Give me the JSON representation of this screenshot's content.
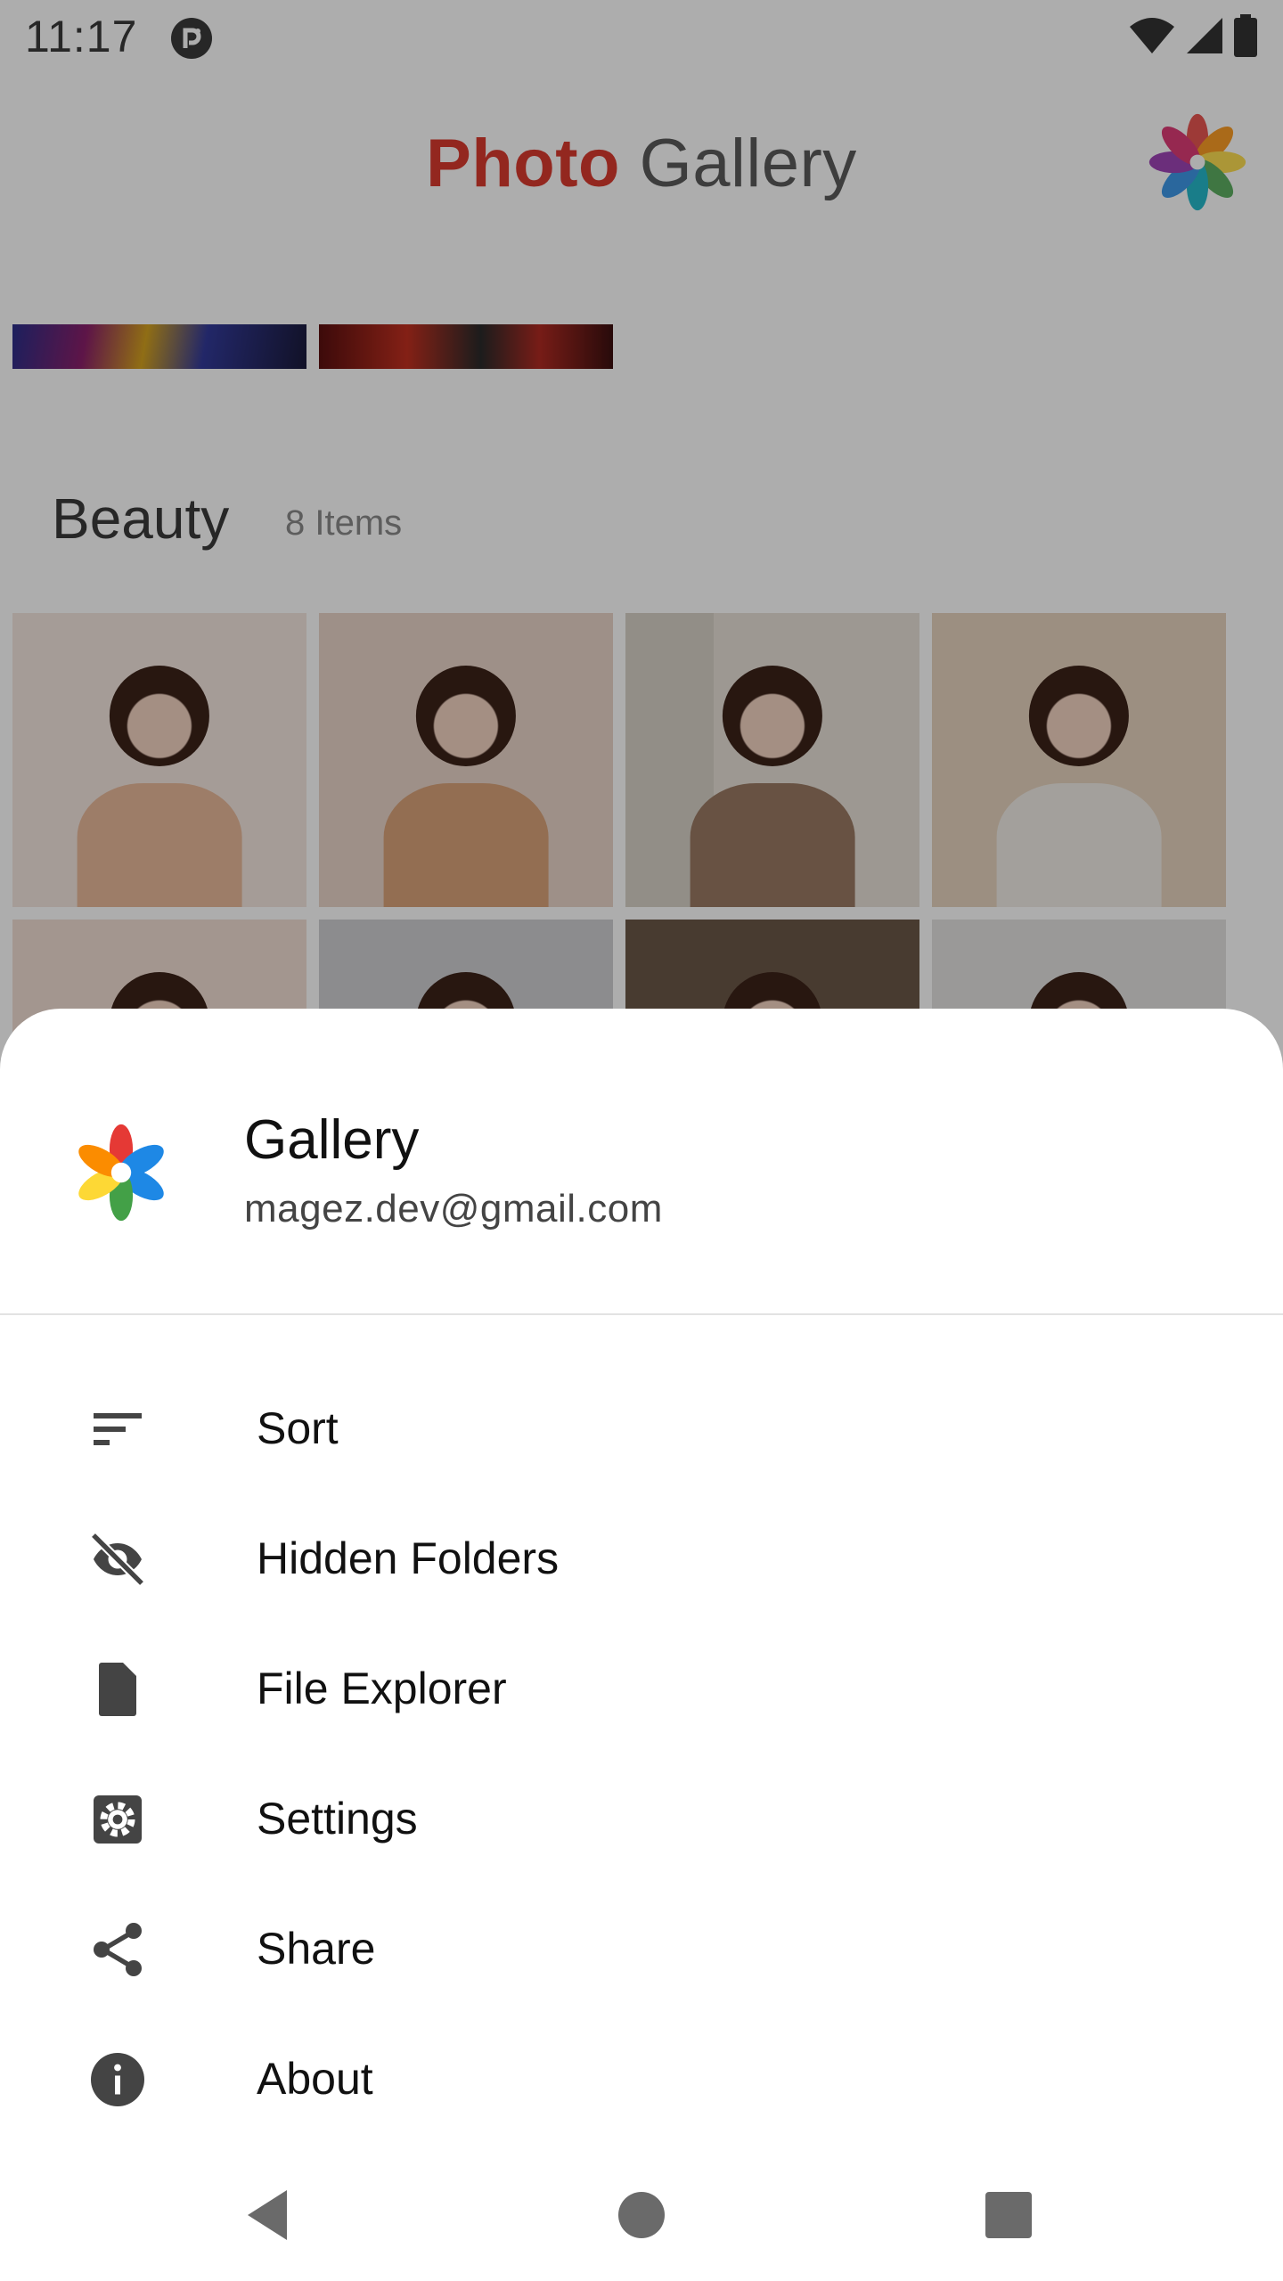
{
  "status_bar": {
    "time": "11:17"
  },
  "app": {
    "title_accent": "Photo",
    "title_rest": "Gallery",
    "section": {
      "title": "Beauty",
      "count": "8 Items"
    }
  },
  "sheet": {
    "title": "Gallery",
    "subtitle": "magez.dev@gmail.com",
    "items": [
      {
        "label": "Sort",
        "icon": "sort-icon"
      },
      {
        "label": "Hidden Folders",
        "icon": "eye-off-icon"
      },
      {
        "label": "File Explorer",
        "icon": "file-icon"
      },
      {
        "label": "Settings",
        "icon": "settings-icon"
      },
      {
        "label": "Share",
        "icon": "share-icon"
      },
      {
        "label": "About",
        "icon": "info-icon"
      }
    ]
  },
  "nav_bar": {
    "back_icon": "back-triangle-icon",
    "home_icon": "home-circle-icon",
    "recents_icon": "recents-square-icon"
  },
  "colors": {
    "accent": "#d93a2f",
    "scrim": "rgba(0,0,0,0.32)",
    "icon": "#444444",
    "text": "#111111"
  }
}
